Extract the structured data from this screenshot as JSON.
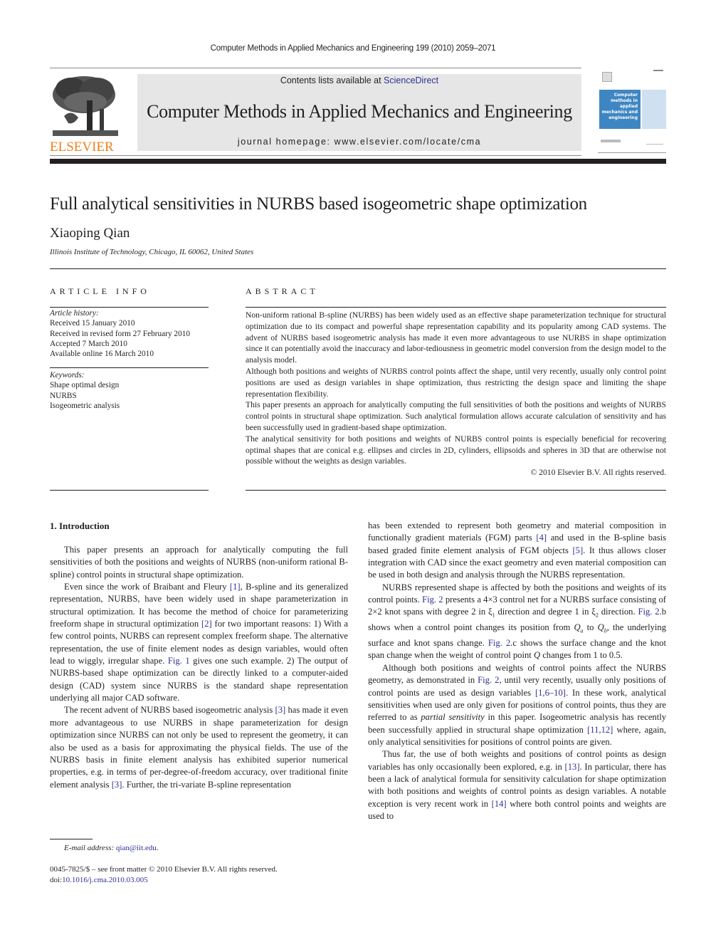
{
  "header": {
    "running_head": "Computer Methods in Applied Mechanics and Engineering 199 (2010) 2059–2071",
    "publisher": "ELSEVIER",
    "contents_prefix": "Contents lists available at ",
    "contents_link": "ScienceDirect",
    "journal_title": "Computer Methods in Applied Mechanics and Engineering",
    "homepage": "journal homepage: www.elsevier.com/locate/cma",
    "cover_text": "Computer methods in applied mechanics and engineering",
    "colors": {
      "publisher_orange": "#f07f1a",
      "link_blue": "#2e3192",
      "banner_gray": "#e6e6e6",
      "cover_blue": "#3e86c2"
    }
  },
  "article": {
    "title": "Full analytical sensitivities in NURBS based isogeometric shape optimization",
    "author": "Xiaoping Qian",
    "affiliation": "Illinois Institute of Technology, Chicago, IL 60062, United States"
  },
  "article_info": {
    "heading": "ARTICLE INFO",
    "history_label": "Article history:",
    "history": [
      "Received 15 January 2010",
      "Received in revised form 27 February 2010",
      "Accepted 7 March 2010",
      "Available online 16 March 2010"
    ],
    "keywords_label": "Keywords:",
    "keywords": [
      "Shape optimal design",
      "NURBS",
      "Isogeometric analysis"
    ]
  },
  "abstract": {
    "heading": "ABSTRACT",
    "paragraphs": [
      "Non-uniform rational B-spline (NURBS) has been widely used as an effective shape parameterization technique for structural optimization due to its compact and powerful shape representation capability and its popularity among CAD systems. The advent of NURBS based isogeometric analysis has made it even more advantageous to use NURBS in shape optimization since it can potentially avoid the inaccuracy and labor-tediousness in geometric model conversion from the design model to the analysis model.",
      "Although both positions and weights of NURBS control points affect the shape, until very recently, usually only control point positions are used as design variables in shape optimization, thus restricting the design space and limiting the shape representation flexibility.",
      "This paper presents an approach for analytically computing the full sensitivities of both the positions and weights of NURBS control points in structural shape optimization. Such analytical formulation allows accurate calculation of sensitivity and has been successfully used in gradient-based shape optimization.",
      "The analytical sensitivity for both positions and weights of NURBS control points is especially beneficial for recovering optimal shapes that are conical e.g. ellipses and circles in 2D, cylinders, ellipsoids and spheres in 3D that are otherwise not possible without the weights as design variables."
    ],
    "copyright": "© 2010 Elsevier B.V. All rights reserved."
  },
  "body": {
    "intro_heading": "1. Introduction",
    "left": {
      "p1": "This paper presents an approach for analytically computing the full sensitivities of both the positions and weights of NURBS (non-uniform rational B-spline) control points in structural shape optimization.",
      "p2a": "Even since the work of Braibant and Fleury ",
      "p2_ref1": "[1]",
      "p2b": ", B-spline and its generalized representation, NURBS, have been widely used in shape parameterization in structural optimization. It has become the method of choice for parameterizing freeform shape in structural optimization ",
      "p2_ref2": "[2]",
      "p2c": " for two important reasons: 1) With a few control points, NURBS can represent complex freeform shape. The alternative representation, the use of finite element nodes as design variables, would often lead to wiggly, irregular shape. ",
      "p2_fig1": "Fig. 1",
      "p2d": " gives one such example. 2) The output of NURBS-based shape optimization can be directly linked to a computer-aided design (CAD) system since NURBS is the standard shape representation underlying all major CAD software.",
      "p3a": "The recent advent of NURBS based isogeometric analysis ",
      "p3_ref3": "[3]",
      "p3b": " has made it even more advantageous to use NURBS in shape parameterization for design optimization since NURBS can not only be used to represent the geometry, it can also be used as a basis for approximating the physical fields. The use of the NURBS basis in finite element analysis has exhibited superior numerical properties, e.g. in terms of per-degree-of-freedom accuracy, over traditional finite element analysis ",
      "p3_ref3b": "[3]",
      "p3c": ". Further, the tri-variate B-spline representation"
    },
    "right": {
      "p1a": "has been extended to represent both geometry and material composition in functionally gradient materials (FGM) parts ",
      "p1_ref4": "[4]",
      "p1b": " and used in the B-spline basis based graded finite element analysis of FGM objects ",
      "p1_ref5": "[5]",
      "p1c": ". It thus allows closer integration with CAD since the exact geometry and even material composition can be used in both design and analysis through the NURBS representation.",
      "p2a": "NURBS represented shape is affected by both the positions and weights of its control points. ",
      "p2_fig2": "Fig. 2",
      "p2b": " presents a 4×3 control net for a NURBS surface consisting of 2×2 knot spans with degree 2 in ξ",
      "p2_sub1": "1",
      "p2c": " direction and degree 1 in ξ",
      "p2_sub2": "2",
      "p2d": " direction. ",
      "p2_fig2b": "Fig. 2",
      "p2e": ".b shows when a control point changes its position from ",
      "p2_qa": "Q",
      "p2_qa_sub": "a",
      "p2f": " to ",
      "p2_qb": "Q",
      "p2_qb_sub": "b",
      "p2g": ", the underlying surface and knot spans change. ",
      "p2_fig2c": "Fig. 2",
      "p2h": ".c shows the surface change and the knot span change when the weight of control point ",
      "p2_q": "Q",
      "p2i": " changes from 1 to 0.5.",
      "p3a": "Although both positions and weights of control points affect the NURBS geometry, as demonstrated in ",
      "p3_fig2": "Fig. 2",
      "p3b": ", until very recently, usually only positions of control points are used as design variables ",
      "p3_ref": "[1,6–10]",
      "p3c": ". In these work, analytical sensitivities when used are only given for positions of control points, thus they are referred to as ",
      "p3_em": "partial sensitivity",
      "p3d": " in this paper. Isogeometric analysis has recently been successfully applied in structural shape optimization ",
      "p3_ref2": "[11,12]",
      "p3e": " where, again, only analytical sensitivities for positions of control points are given.",
      "p4a": "Thus far, the use of both weights and positions of control points as design variables has only occasionally been explored, e.g. in ",
      "p4_ref13": "[13]",
      "p4b": ". In particular, there has been a lack of analytical formula for sensitivity calculation for shape optimization with both positions and weights of control points as design variables. A notable exception is very recent work in ",
      "p4_ref14": "[14]",
      "p4c": " where both control points and weights are used to"
    }
  },
  "footer": {
    "email_label": "E-mail address:",
    "email": "qian@iit.edu",
    "email_end": ".",
    "issn_line": "0045-7825/$ – see front matter © 2010 Elsevier B.V. All rights reserved.",
    "doi_label": "doi:",
    "doi": "10.1016/j.cma.2010.03.005"
  }
}
